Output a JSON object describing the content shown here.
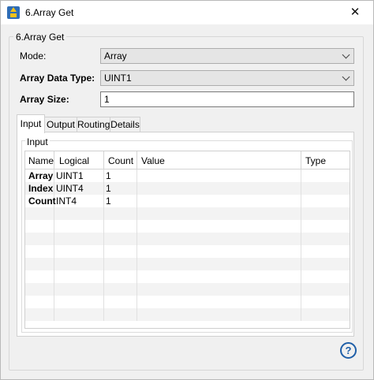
{
  "window": {
    "title": "6.Array Get",
    "close_glyph": "✕"
  },
  "group": {
    "label": "6.Array Get"
  },
  "form": {
    "mode_label": "Mode:",
    "mode_value": "Array",
    "type_label": "Array Data Type:",
    "type_value": "UINT1",
    "size_label": "Array Size:",
    "size_value": "1"
  },
  "tabs": [
    {
      "label": "Input",
      "active": true
    },
    {
      "label": "Output"
    },
    {
      "label": "Routing"
    },
    {
      "label": "Details"
    }
  ],
  "input_panel": {
    "label": "Input"
  },
  "table": {
    "columns": [
      "Name",
      "Logical",
      "Count",
      "Value",
      "Type"
    ],
    "rows": [
      {
        "name": "Array",
        "logical": "UINT1",
        "count": "1",
        "value": "",
        "type": ""
      },
      {
        "name": "Index",
        "logical": "UINT4",
        "count": "1",
        "value": "",
        "type": ""
      },
      {
        "name": "Count",
        "logical": "INT4",
        "count": "1",
        "value": "",
        "type": ""
      }
    ]
  },
  "help": {
    "glyph": "?"
  }
}
